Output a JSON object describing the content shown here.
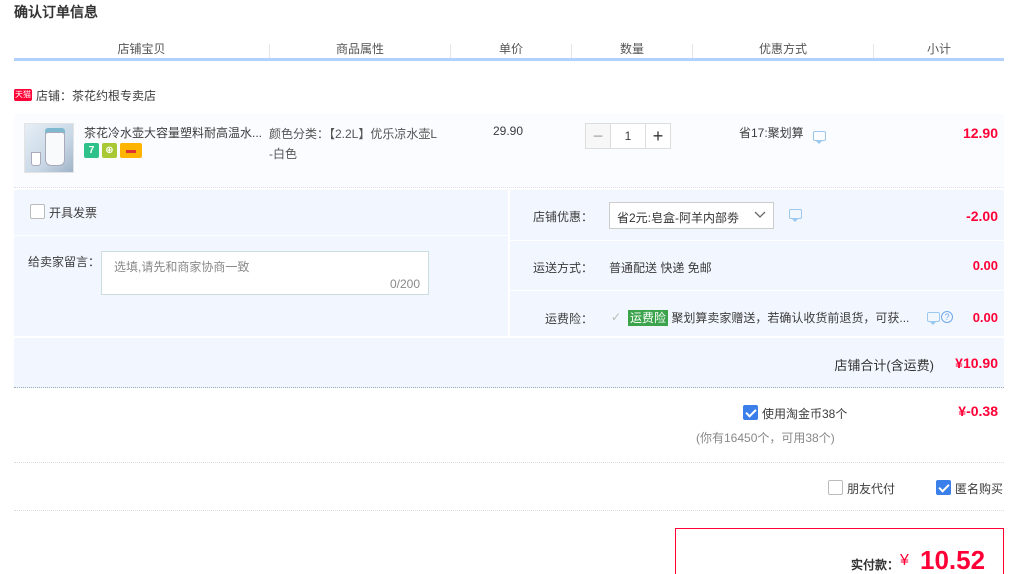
{
  "page": {
    "title": "确认订单信息"
  },
  "columns": [
    "店铺宝贝",
    "商品属性",
    "单价",
    "数量",
    "优惠方式",
    "小计"
  ],
  "shop": {
    "badge": "天猫",
    "label": "店铺：茶花约根专卖店"
  },
  "item": {
    "title": "茶花冷水壶大容量塑料耐高温水...",
    "badge1": "7",
    "badge2": "⊕",
    "badge3": "▬",
    "attr_line1": "颜色分类：【2.2L】优乐凉水壶L",
    "attr_line2": "-白色",
    "price": "29.90",
    "qty_minus": "−",
    "qty": "1",
    "qty_plus": "+",
    "promo": "省17:聚划算",
    "subtotal": "12.90"
  },
  "invoice": {
    "label": "开具发票",
    "checked": false
  },
  "message": {
    "label": "给卖家留言：",
    "placeholder": "选填,请先和商家协商一致",
    "counter": "0/200"
  },
  "shop_discount": {
    "label": "店铺优惠：",
    "selected": "省2元:皂盒-阿羊内部劵",
    "amount": "-2.00"
  },
  "shipping": {
    "label": "运送方式：",
    "value": "普通配送 快递 免邮",
    "amount": "0.00"
  },
  "insurance": {
    "label": "运费险：",
    "tag": "运费险",
    "text": "聚划算卖家赠送，若确认收货前退货，可获...",
    "help": "?",
    "amount": "0.00"
  },
  "shop_total": {
    "label": "店铺合计(含运费)",
    "amount": "¥10.90"
  },
  "coins": {
    "label": "使用淘金币38个",
    "amount": "¥-0.38",
    "note": "(你有16450个，可用38个)",
    "checked": true
  },
  "friend_pay": {
    "label": "朋友代付",
    "checked": false
  },
  "anonymous": {
    "label": "匿名购买",
    "checked": true
  },
  "payment": {
    "label": "实付款：",
    "symbol": "¥",
    "amount": "10.52"
  },
  "colors": {
    "accent": "#ff0036",
    "header_line": "#b2d1ff",
    "panel_bg": "#f2f7ff",
    "checkbox_on": "#3a7fea"
  }
}
